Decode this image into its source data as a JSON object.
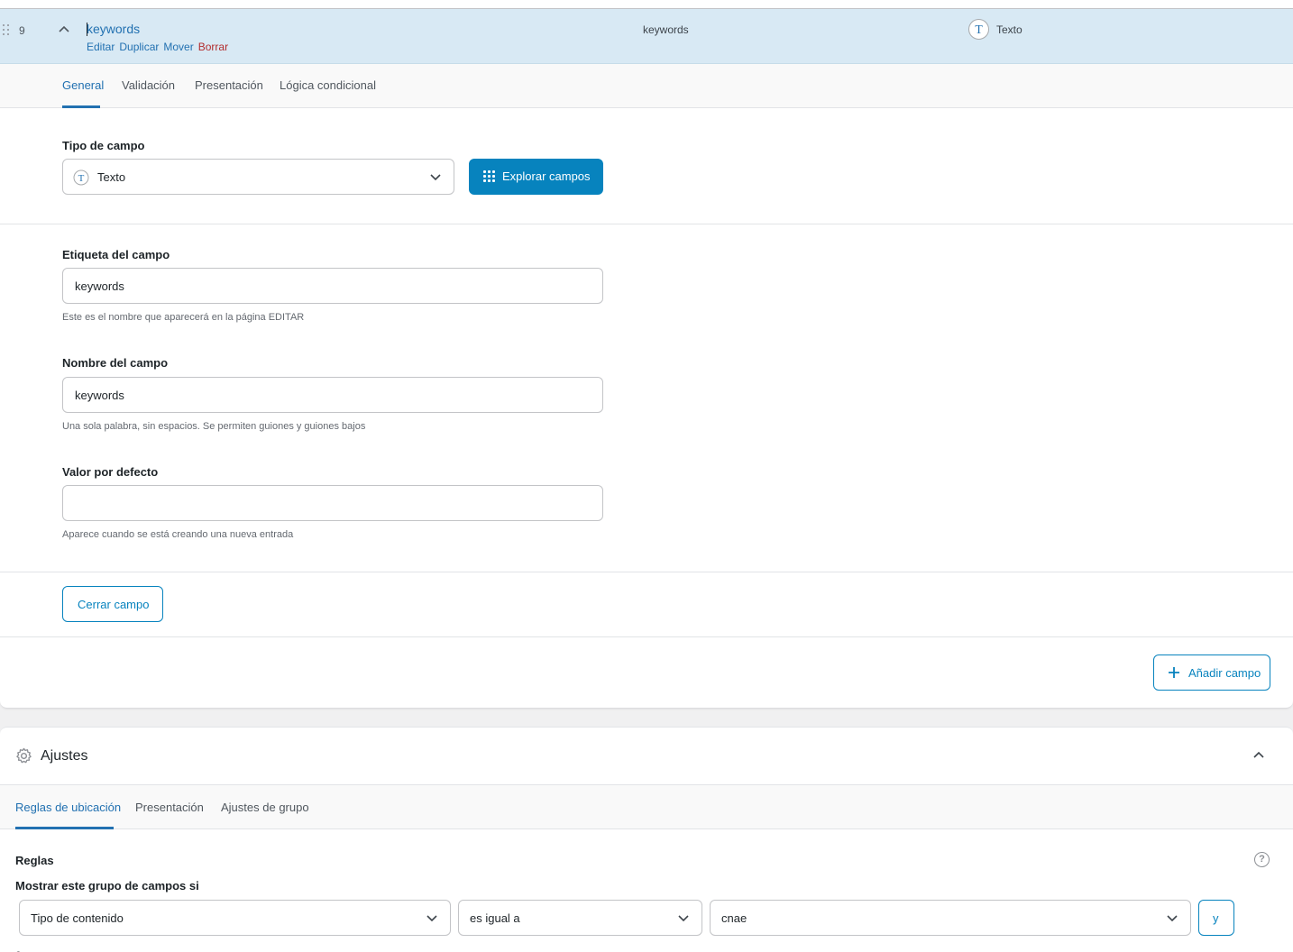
{
  "field_row": {
    "number": "9",
    "title": "keywords",
    "actions": [
      "Editar",
      "Duplicar",
      "Mover",
      "Borrar"
    ],
    "name": "keywords",
    "type_icon": "T",
    "type_label": "Texto"
  },
  "field_tabs": [
    "General",
    "Validación",
    "Presentación",
    "Lógica condicional"
  ],
  "field_type": {
    "label": "Tipo de campo",
    "icon": "T",
    "value": "Texto",
    "explore_button": "Explorar campos"
  },
  "field_label": {
    "label": "Etiqueta del campo",
    "value": "keywords",
    "help": "Este es el nombre que aparecerá en la página EDITAR"
  },
  "field_name": {
    "label": "Nombre del campo",
    "value": "keywords",
    "help": "Una sola palabra, sin espacios. Se permiten guiones y guiones bajos"
  },
  "default_value": {
    "label": "Valor por defecto",
    "value": "",
    "help": "Aparece cuando se está creando una nueva entrada"
  },
  "close_field_button": "Cerrar campo",
  "add_field_button": "Añadir campo",
  "settings": {
    "title": "Ajustes",
    "tabs": [
      "Reglas de ubicación",
      "Presentación",
      "Ajustes de grupo"
    ],
    "rules_title": "Reglas",
    "rules_subtitle": "Mostrar este grupo de campos si",
    "rule": {
      "param": "Tipo de contenido",
      "operator": "es igual a",
      "value": "cnae",
      "and_button": "y"
    },
    "cut_text": "o"
  },
  "colors": {
    "accent": "#2271b1",
    "primary_button": "#0783be",
    "row_highlight": "#d8e9f4",
    "danger": "#b32d2e"
  },
  "icons": [
    "drag-handle-icon",
    "chevron-up-icon",
    "text-type-icon",
    "chevron-down-icon",
    "grid-icon",
    "plus-icon",
    "gear-icon",
    "help-icon"
  ]
}
